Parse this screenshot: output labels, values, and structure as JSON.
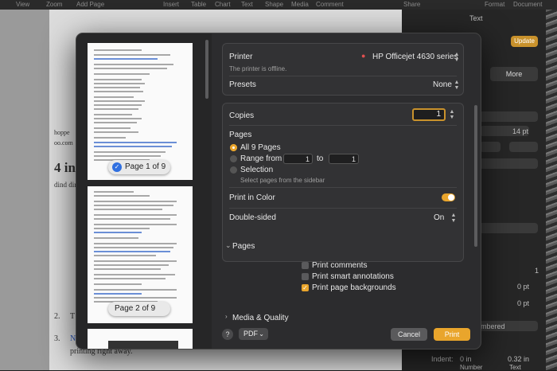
{
  "background": {
    "menu": [
      "View",
      "Zoom",
      "Add Page",
      "Insert",
      "Table",
      "Chart",
      "Text",
      "Shape",
      "Media",
      "Comment",
      "Share",
      "Format",
      "Document"
    ],
    "sidebar": {
      "tab_text": "Text",
      "update_label": "Update",
      "out_label": "ut",
      "more_label": "More",
      "font_size": "14 pt",
      "list_style": "mbered",
      "indent_label": "Indent:",
      "indent_number": "0 in",
      "indent_text": "0.32 in",
      "col_number": "Number",
      "col_text": "Text",
      "spin_1": "1",
      "spin_0a": "0 pt",
      "spin_0b": "0 pt",
      "spin_0c": "1"
    },
    "doc": {
      "frag_4": "4 in",
      "frag_dir": "dind dir",
      "frag_hop": "hoppe",
      "frag_oo": "oo.com",
      "list_2": "2.",
      "list_3": "3.",
      "frag_t": "T",
      "frag_n": "N",
      "frag_tail": "printing right away."
    }
  },
  "dialog": {
    "preview": {
      "page1_badge": "Page 1 of 9",
      "page2_badge": "Page 2 of 9"
    },
    "printer": {
      "label": "Printer",
      "name": "HP Officejet 4630 series",
      "status": "The printer is offline."
    },
    "presets": {
      "label": "Presets",
      "value": "None"
    },
    "copies": {
      "label": "Copies",
      "value": "1"
    },
    "pages": {
      "label": "Pages",
      "all": "All 9 Pages",
      "range_label": "Range from",
      "range_from": "1",
      "range_to_label": "to",
      "range_to": "1",
      "selection": "Selection",
      "selection_hint": "Select pages from the sidebar"
    },
    "print_in_color": {
      "label": "Print in Color"
    },
    "double_sided": {
      "label": "Double-sided",
      "value": "On"
    },
    "pages_section": {
      "title": "Pages",
      "print_comments": "Print comments",
      "print_smart_annotations": "Print smart annotations",
      "print_page_backgrounds": "Print page backgrounds"
    },
    "media_quality": {
      "title": "Media & Quality"
    },
    "footer": {
      "help": "?",
      "pdf": "PDF",
      "cancel": "Cancel",
      "print": "Print"
    }
  }
}
